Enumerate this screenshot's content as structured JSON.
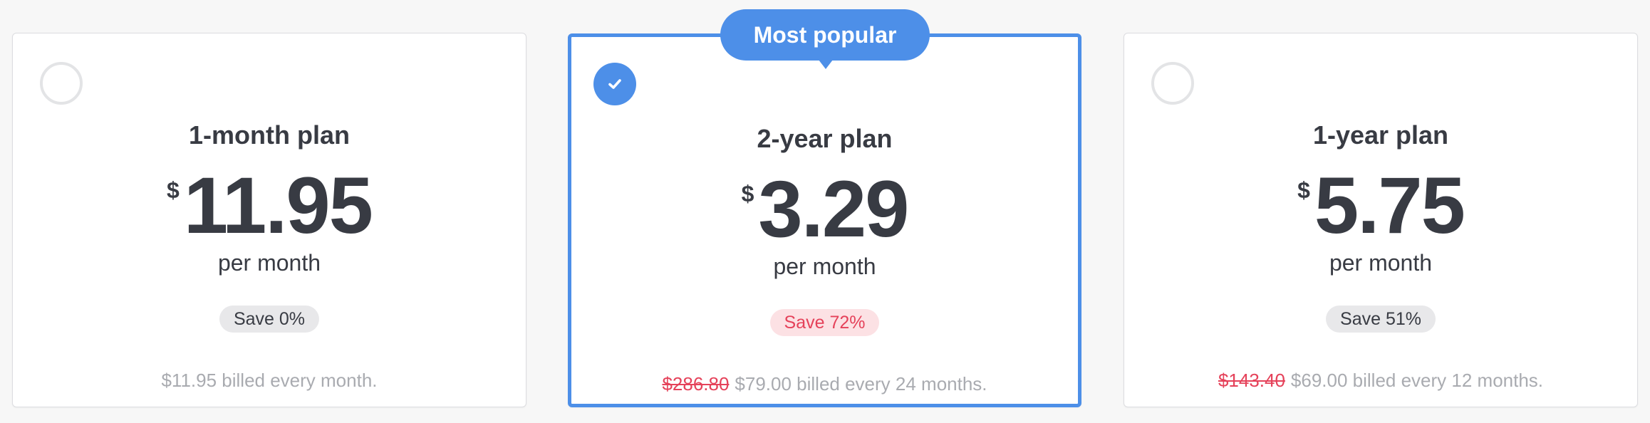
{
  "plans": [
    {
      "title": "1-month plan",
      "currency": "$",
      "amount": "11.95",
      "period": "per month",
      "save": "Save 0%",
      "original_price": "",
      "billing": "$11.95 billed every month.",
      "selected": false
    },
    {
      "title": "2-year plan",
      "currency": "$",
      "amount": "3.29",
      "period": "per month",
      "save": "Save 72%",
      "original_price": "$286.80",
      "billing": "$79.00 billed every 24 months.",
      "selected": true,
      "badge": "Most popular"
    },
    {
      "title": "1-year plan",
      "currency": "$",
      "amount": "5.75",
      "period": "per month",
      "save": "Save 51%",
      "original_price": "$143.40",
      "billing": "$69.00 billed every 12 months.",
      "selected": false
    }
  ],
  "icons": {
    "selected": "check-icon",
    "unselected": "radio-circle-icon"
  },
  "colors": {
    "accent": "#4d8fe8",
    "discount": "#e5425a",
    "text": "#383b43",
    "muted": "#a9abb0"
  }
}
